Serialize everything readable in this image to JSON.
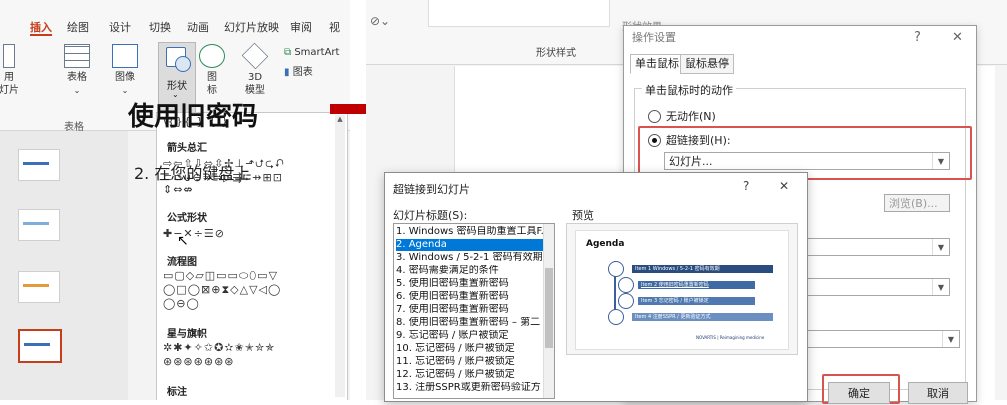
{
  "ribbon": {
    "tabs": [
      "插入",
      "绘图",
      "设计",
      "切换",
      "动画",
      "幻灯片放映",
      "审阅",
      "视图"
    ],
    "active_tab": "插入",
    "buttons": {
      "new_slide_partial": "用\n灯片",
      "table": "表格",
      "image": "图像",
      "shapes": "形状",
      "icons": "图\n标",
      "model3d": "3D\n模型",
      "smartart": "SmartArt",
      "chart": "图表",
      "table_group": "表格"
    }
  },
  "shape_gallery": {
    "top_row": "\\{}{ } { }",
    "sections": [
      {
        "title": "箭头总汇",
        "rows": [
          "⇨⇦⇧⇩⬄⇳✢⊥⬏⮍⮎⮏",
          "⊂⊃⊍⊖⇒⇒▷⇶⮓⇸⊞⊡",
          "⇕⇔⇎"
        ]
      },
      {
        "title": "公式形状",
        "rows": [
          "✚−✕÷☰⊘"
        ]
      },
      {
        "title": "流程图",
        "rows": [
          "▭▢◇▱◫▭▭⬭⬯▭▽",
          "◯□◯⊠⊕⧗◇△▽◁◯",
          "◯⊖◯"
        ]
      },
      {
        "title": "星与旗帜",
        "rows": [
          "✲✱✦✧✩✪✫✬✭✮✯",
          "⊛⊛⊛⊛⊛⊛⊛"
        ]
      },
      {
        "title": "标注",
        "rows": []
      }
    ]
  },
  "slide": {
    "title": "使用旧密码",
    "bullet": "2. 在您的键盘上",
    "shape_styles_label": "形状样式",
    "shape_effects_label": "形状效果"
  },
  "action_dialog": {
    "title": "操作设置",
    "help": "?",
    "close": "✕",
    "tabs": [
      "单击鼠标",
      "鼠标悬停"
    ],
    "group_label": "单击鼠标时的动作",
    "radio_none": "无动作(N)",
    "radio_link": "超链接到(H):",
    "link_value": "幻灯片...",
    "browse_label": "浏览(B)...",
    "ok_label": "确定",
    "cancel_label": "取消"
  },
  "hyperlink_dialog": {
    "title": "超链接到幻灯片",
    "help": "?",
    "close": "✕",
    "list_label": "幻灯片标题(S):",
    "preview_label": "预览",
    "slides": [
      "1. Windows 密码自助重置工具F...",
      "2. Agenda",
      "3. Windows / 5-2-1 密码有效期",
      "4. 密码需要满足的条件",
      "5. 使用旧密码重置新密码",
      "6. 使用旧密码重置新密码",
      "7. 使用旧密码重置新密码",
      "8. 使用旧密码重置新密码 – 第二",
      "9. 忘记密码 / 账户被锁定",
      "10. 忘记密码 / 账户被锁定",
      "11. 忘记密码 / 账户被锁定",
      "12. 忘记密码 / 账户被锁定",
      "13. 注册SSPR或更新密码验证方"
    ],
    "selected_index": 1,
    "preview": {
      "title": "Agenda",
      "items": [
        "Item 1  Windows / 5-2-1 密码有效期",
        "Item 2  使用旧密码重置新密码",
        "Item 3  忘记密码 / 账户被锁定",
        "Item 4  注册SSPR / 更新验证方式"
      ],
      "footer": "NOVARTIS | Reimagining medicine"
    }
  },
  "colors": {
    "accent_red": "#c00000",
    "highlight_box": "#d9534f",
    "selection_blue": "#0078d7",
    "preview_bar": "#2b4c7e"
  }
}
